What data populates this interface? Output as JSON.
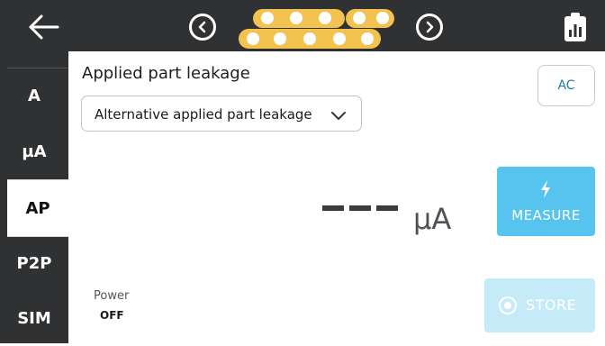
{
  "header": {
    "back_icon": "arrow-left-icon",
    "prev_icon": "chevron-left-circle-icon",
    "next_icon": "chevron-right-circle-icon",
    "connector_icon": "connector-pins-icon",
    "report_icon": "clipboard-chart-icon"
  },
  "sidebar": {
    "items": [
      {
        "label": "A",
        "active": false
      },
      {
        "label": "µA",
        "active": false
      },
      {
        "label": "AP",
        "active": true
      },
      {
        "label": "P2P",
        "active": false
      },
      {
        "label": "SIM",
        "active": false
      }
    ]
  },
  "main": {
    "title": "Applied part leakage",
    "dropdown": {
      "selected": "Alternative applied part leakage",
      "icon": "chevron-down-icon"
    },
    "ac_button": "AC",
    "reading": {
      "unit": "µA"
    },
    "measure": {
      "label": "MEASURE",
      "icon": "lightning-bolt-icon",
      "color": "#56c4ee"
    },
    "store": {
      "label": "STORE",
      "icon": "record-circle-icon",
      "color": "#c6ebf8"
    },
    "power": {
      "label": "Power",
      "value": "OFF"
    }
  },
  "colors": {
    "topbar": "#2f3133",
    "connector": "#f4c24f",
    "accent_text": "#1e7ba3"
  }
}
